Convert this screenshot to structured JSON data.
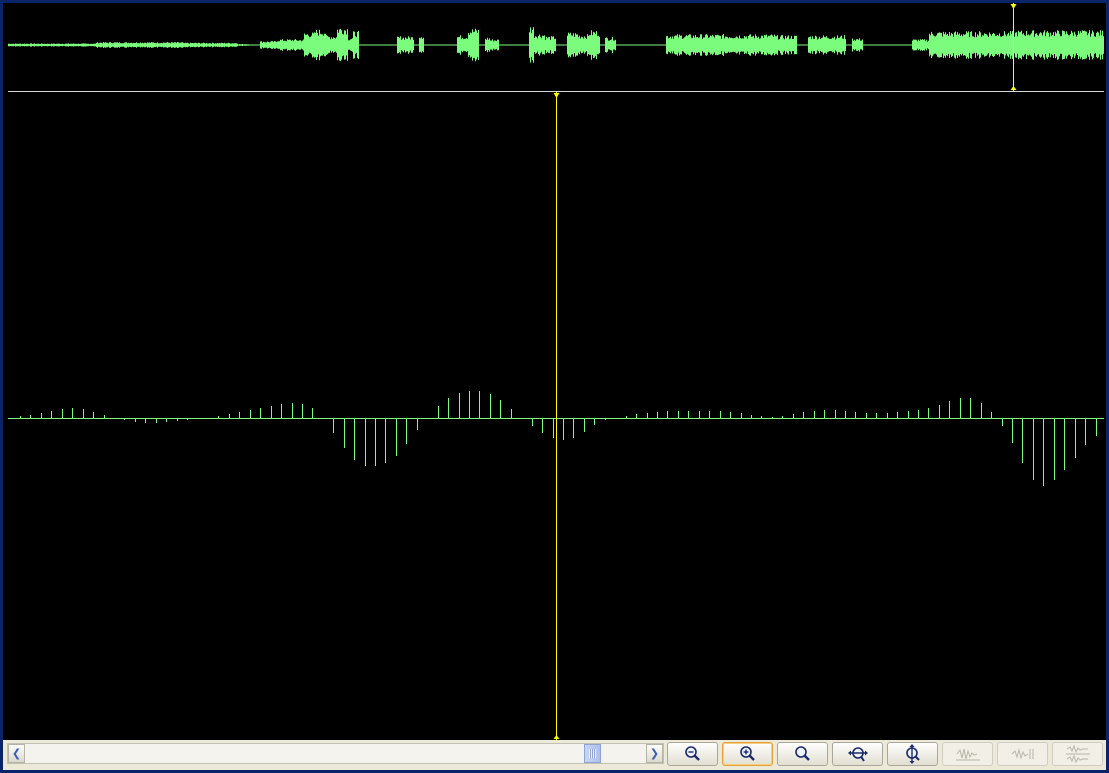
{
  "colors": {
    "waveform": "#7cfc7c",
    "cursor": "#ffff00",
    "background": "#000000",
    "divider": "#d8d8d8"
  },
  "scrollbar": {
    "left_icon": "chevron-left-icon",
    "right_icon": "chevron-right-icon",
    "position": 0.9
  },
  "toolbar": {
    "buttons": [
      {
        "icon": "zoom-out-icon",
        "state": "normal"
      },
      {
        "icon": "zoom-in-icon",
        "state": "active"
      },
      {
        "icon": "zoom-normal-icon",
        "state": "normal"
      },
      {
        "icon": "zoom-horizontal-icon",
        "state": "normal"
      },
      {
        "icon": "zoom-vertical-icon",
        "state": "normal"
      },
      {
        "icon": "waveform-view-icon",
        "state": "disabled"
      },
      {
        "icon": "waveform-split-icon",
        "state": "disabled"
      },
      {
        "icon": "waveform-stack-icon",
        "state": "disabled"
      }
    ]
  },
  "overview": {
    "cursor_position": 0.917,
    "segments": [
      [
        0.0,
        0.08,
        0.08
      ],
      [
        0.08,
        0.16,
        0.15
      ],
      [
        0.16,
        0.21,
        0.12
      ],
      [
        0.21,
        0.22,
        0.05
      ],
      [
        0.23,
        0.245,
        0.2
      ],
      [
        0.245,
        0.27,
        0.3
      ],
      [
        0.27,
        0.28,
        0.65
      ],
      [
        0.28,
        0.29,
        0.8
      ],
      [
        0.29,
        0.3,
        0.5
      ],
      [
        0.3,
        0.31,
        0.95
      ],
      [
        0.31,
        0.315,
        0.4
      ],
      [
        0.315,
        0.32,
        0.7
      ],
      [
        0.355,
        0.37,
        0.45
      ],
      [
        0.375,
        0.38,
        0.55
      ],
      [
        0.41,
        0.42,
        0.5
      ],
      [
        0.42,
        0.43,
        0.85
      ],
      [
        0.435,
        0.44,
        0.4
      ],
      [
        0.44,
        0.448,
        0.3
      ],
      [
        0.475,
        0.48,
        1.0
      ],
      [
        0.48,
        0.49,
        0.6
      ],
      [
        0.49,
        0.5,
        0.45
      ],
      [
        0.51,
        0.52,
        0.65
      ],
      [
        0.52,
        0.53,
        0.55
      ],
      [
        0.53,
        0.54,
        0.75
      ],
      [
        0.545,
        0.555,
        0.4
      ],
      [
        0.6,
        0.7,
        0.55
      ],
      [
        0.7,
        0.72,
        0.5
      ],
      [
        0.73,
        0.765,
        0.5
      ],
      [
        0.77,
        0.78,
        0.35
      ],
      [
        0.825,
        0.84,
        0.3
      ],
      [
        0.84,
        0.92,
        0.7
      ],
      [
        0.92,
        1.0,
        0.75
      ]
    ]
  },
  "detail": {
    "cursor_position": 0.5,
    "samples": [
      0.02,
      0.03,
      0.05,
      0.07,
      0.09,
      0.1,
      0.09,
      0.06,
      0.03,
      0.0,
      -0.02,
      -0.04,
      -0.05,
      -0.05,
      -0.04,
      -0.03,
      -0.02,
      -0.01,
      0.0,
      0.02,
      0.04,
      0.06,
      0.08,
      0.1,
      0.12,
      0.14,
      0.15,
      0.14,
      0.1,
      0.0,
      -0.15,
      -0.3,
      -0.42,
      -0.48,
      -0.48,
      -0.45,
      -0.38,
      -0.26,
      -0.12,
      0.0,
      0.12,
      0.2,
      0.25,
      0.27,
      0.27,
      0.24,
      0.18,
      0.09,
      0.0,
      -0.08,
      -0.15,
      -0.2,
      -0.22,
      -0.2,
      -0.14,
      -0.07,
      -0.02,
      0.0,
      0.02,
      0.04,
      0.05,
      0.06,
      0.07,
      0.07,
      0.07,
      0.07,
      0.07,
      0.07,
      0.06,
      0.05,
      0.03,
      0.02,
      0.01,
      0.02,
      0.04,
      0.06,
      0.07,
      0.08,
      0.08,
      0.07,
      0.06,
      0.05,
      0.05,
      0.05,
      0.06,
      0.07,
      0.08,
      0.1,
      0.13,
      0.17,
      0.2,
      0.2,
      0.15,
      0.06,
      -0.08,
      -0.25,
      -0.45,
      -0.62,
      -0.68,
      -0.62,
      -0.52,
      -0.4,
      -0.27,
      -0.18
    ]
  }
}
